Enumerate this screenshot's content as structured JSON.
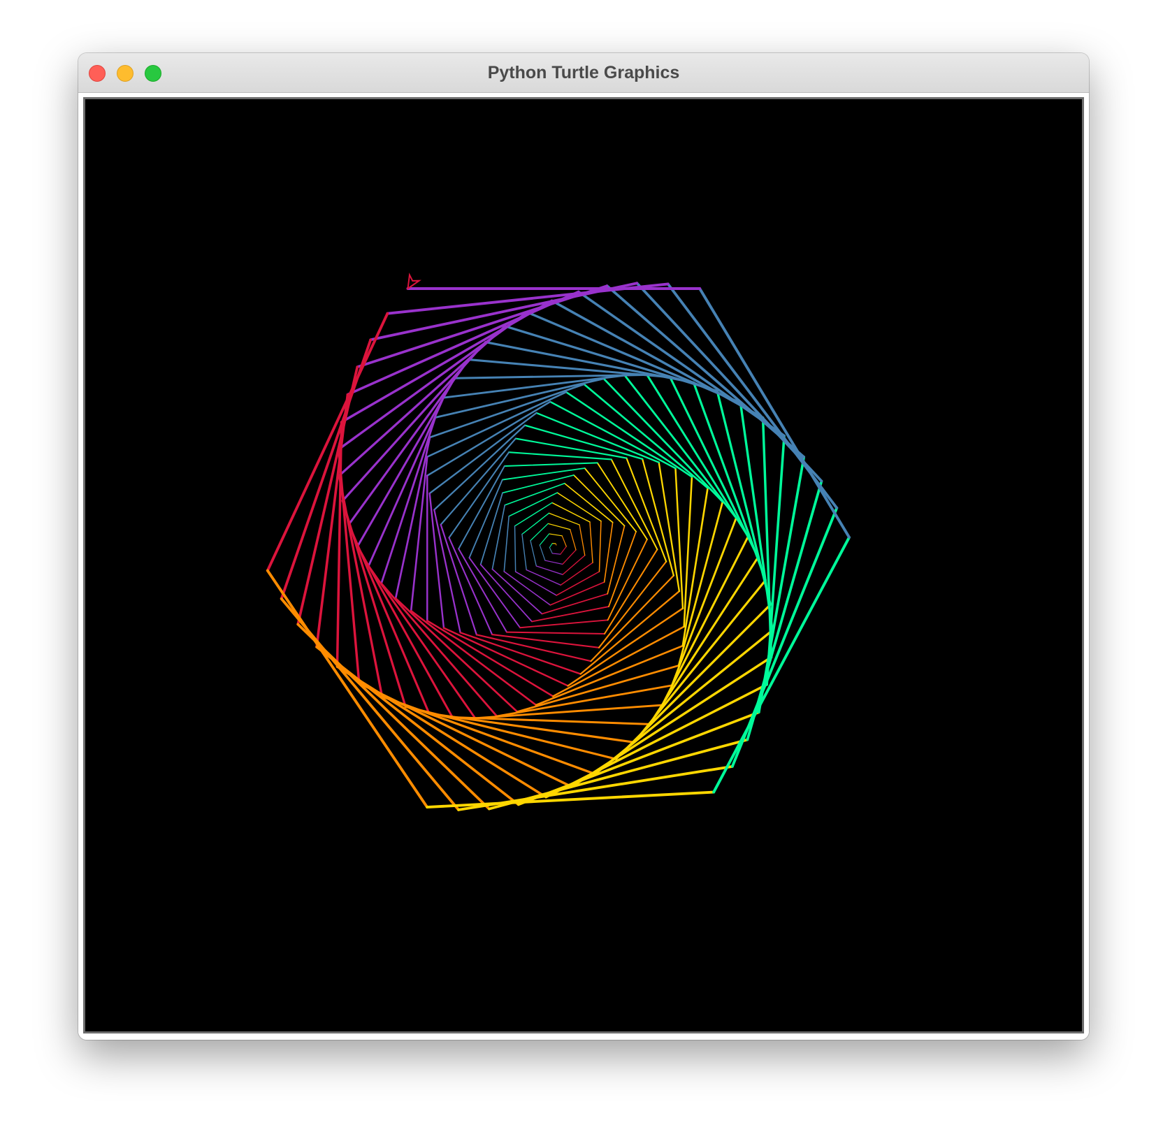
{
  "window": {
    "title": "Python Turtle Graphics"
  },
  "controls": {
    "close": "close-button",
    "minimize": "minimize-button",
    "maximize": "maximize-button"
  },
  "drawing": {
    "background": "#000000",
    "palette": [
      "#dc143c",
      "#ff8c00",
      "#ffd700",
      "#00fa9a",
      "#4682b4",
      "#9932cc"
    ],
    "sides": 6,
    "turn_degrees": 59,
    "turtle_color": "#dc143c"
  }
}
